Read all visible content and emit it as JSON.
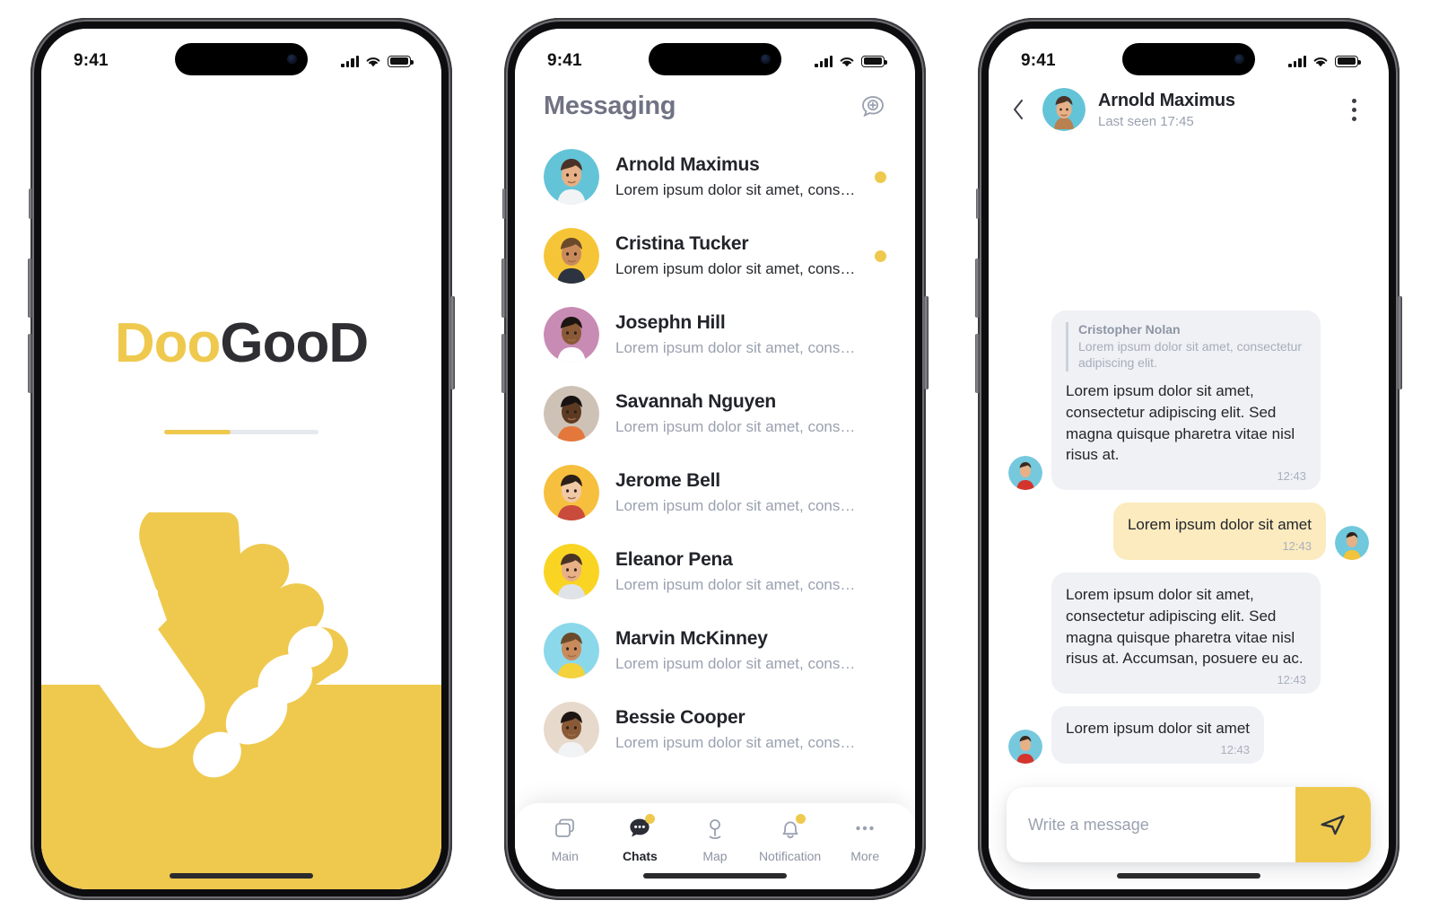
{
  "colors": {
    "yellow": "#efc94e",
    "bubble_in": "#eff1f5",
    "bubble_out": "#fbebbf",
    "dark": "#23252b",
    "muted": "#9aa1b0"
  },
  "status_bar": {
    "time": "9:41",
    "signal_icon": "cellular-signal-icon",
    "wifi_icon": "wifi-icon",
    "battery_icon": "battery-icon"
  },
  "splash": {
    "logo_part_1": "Doo",
    "logo_part_2": "GooD",
    "progress_percent": 43,
    "illustration": "handshake-illustration"
  },
  "messaging": {
    "title": "Messaging",
    "new_chat_icon": "new-message-icon",
    "chats": [
      {
        "name": "Arnold Maximus",
        "preview": "Lorem ipsum dolor sit amet, consectet…",
        "unread": true,
        "avatar_bg": "#63c4d8",
        "avatar": "avatar-arnold-maximus"
      },
      {
        "name": "Cristina Tucker",
        "preview": "Lorem ipsum dolor sit amet, consectet…",
        "unread": true,
        "avatar_bg": "#f6c537",
        "avatar": "avatar-cristina-tucker"
      },
      {
        "name": "Josephn Hill",
        "preview": "Lorem ipsum dolor sit amet, consectet…",
        "unread": false,
        "avatar_bg": "#c88bb4",
        "avatar": "avatar-josephn-hill"
      },
      {
        "name": "Savannah Nguyen",
        "preview": "Lorem ipsum dolor sit amet, consectet…",
        "unread": false,
        "avatar_bg": "#cec2b6",
        "avatar": "avatar-savannah-nguyen"
      },
      {
        "name": "Jerome Bell",
        "preview": "Lorem ipsum dolor sit amet, consectet…",
        "unread": false,
        "avatar_bg": "#f7bf3e",
        "avatar": "avatar-jerome-bell"
      },
      {
        "name": "Eleanor Pena",
        "preview": "Lorem ipsum dolor sit amet, consectet…",
        "unread": false,
        "avatar_bg": "#f9d423",
        "avatar": "avatar-eleanor-pena"
      },
      {
        "name": "Marvin McKinney",
        "preview": "Lorem ipsum dolor sit amet, consectet…",
        "unread": false,
        "avatar_bg": "#8bd8ea",
        "avatar": "avatar-marvin-mckinney"
      },
      {
        "name": "Bessie Cooper",
        "preview": "Lorem ipsum dolor sit amet, consectet…",
        "unread": false,
        "avatar_bg": "#e7d9cb",
        "avatar": "avatar-bessie-cooper"
      }
    ],
    "tabs": [
      {
        "label": "Main",
        "icon": "cards-icon",
        "active": false,
        "badge": false
      },
      {
        "label": "Chats",
        "icon": "chat-bubble-icon",
        "active": true,
        "badge": true
      },
      {
        "label": "Map",
        "icon": "map-pin-icon",
        "active": false,
        "badge": false
      },
      {
        "label": "Notification",
        "icon": "bell-icon",
        "active": false,
        "badge": true
      },
      {
        "label": "More",
        "icon": "more-dots-icon",
        "active": false,
        "badge": false
      }
    ]
  },
  "conversation": {
    "back_icon": "back-chevron-icon",
    "menu_icon": "kebab-menu-icon",
    "contact_name": "Arnold Maximus",
    "last_seen": "Last seen 17:45",
    "contact_avatar": "avatar-arnold-maximus",
    "messages": [
      {
        "side": "in",
        "quote_name": "Cristopher Nolan",
        "quote_text": "Lorem ipsum dolor sit amet, consectetur adipiscing elit.",
        "text": "Lorem ipsum dolor sit amet, consectetur adipiscing elit. Sed magna quisque pharetra vitae nisl risus at.",
        "time": "12:43",
        "show_avatar": true
      },
      {
        "side": "out",
        "text": "Lorem ipsum dolor sit amet",
        "time": "12:43",
        "show_avatar": true
      },
      {
        "side": "in",
        "text": "Lorem ipsum dolor sit amet, consectetur adipiscing elit. Sed magna quisque pharetra vitae nisl risus at. Accumsan, posuere eu ac.",
        "time": "12:43",
        "show_avatar": false
      },
      {
        "side": "in",
        "text": "Lorem ipsum dolor sit amet",
        "time": "12:43",
        "show_avatar": true
      }
    ],
    "composer": {
      "placeholder": "Write a message",
      "value": "",
      "send_icon": "send-paper-plane-icon"
    }
  }
}
